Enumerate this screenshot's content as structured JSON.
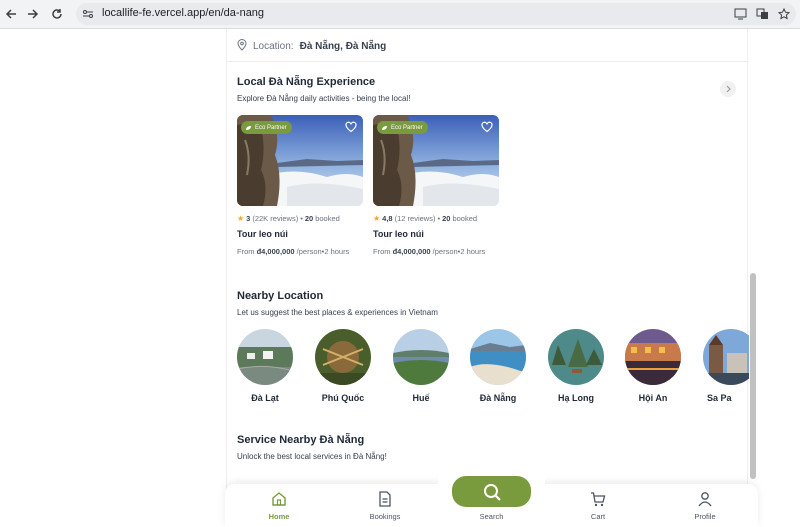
{
  "browser": {
    "url": "locallife-fe.vercel.app/en/da-nang"
  },
  "location": {
    "label": "Location:",
    "value": "Đà Nẵng, Đà Nẵng"
  },
  "experience_section": {
    "title": "Local Đà Nẵng Experience",
    "subtitle": "Explore Đà Nẵng daily activities - being the local!",
    "cards": [
      {
        "badge": "Eco Partner",
        "rating": "3",
        "reviews": "(22K reviews)",
        "booked": "20",
        "booked_label": "booked",
        "title": "Tour leo núi",
        "price_prefix": "From",
        "price": "đ4,000,000",
        "price_suffix": "/person",
        "duration": "2 hours"
      },
      {
        "badge": "Eco Partner",
        "rating": "4,8",
        "reviews": "(12 reviews)",
        "booked": "20",
        "booked_label": "booked",
        "title": "Tour leo núi",
        "price_prefix": "From",
        "price": "đ4,000,000",
        "price_suffix": "/person",
        "duration": "2 hours"
      }
    ]
  },
  "nearby_section": {
    "title": "Nearby Location",
    "subtitle": "Let us suggest the best places & experiences in Vietnam",
    "locations": [
      {
        "name": "Đà Lạt"
      },
      {
        "name": "Phú Quốc"
      },
      {
        "name": "Huế"
      },
      {
        "name": "Đà Nẵng"
      },
      {
        "name": "Hạ Long"
      },
      {
        "name": "Hội An"
      },
      {
        "name": "Sa Pa"
      }
    ]
  },
  "service_section": {
    "title": "Service Nearby Đà Nẵng",
    "subtitle": "Unlock the best local services in Đà Nẵng!"
  },
  "bottom_nav": {
    "home": "Home",
    "bookings": "Bookings",
    "search": "Search",
    "cart": "Cart",
    "profile": "Profile"
  },
  "colors": {
    "accent": "#7a9a3e",
    "star": "#f5a623"
  }
}
